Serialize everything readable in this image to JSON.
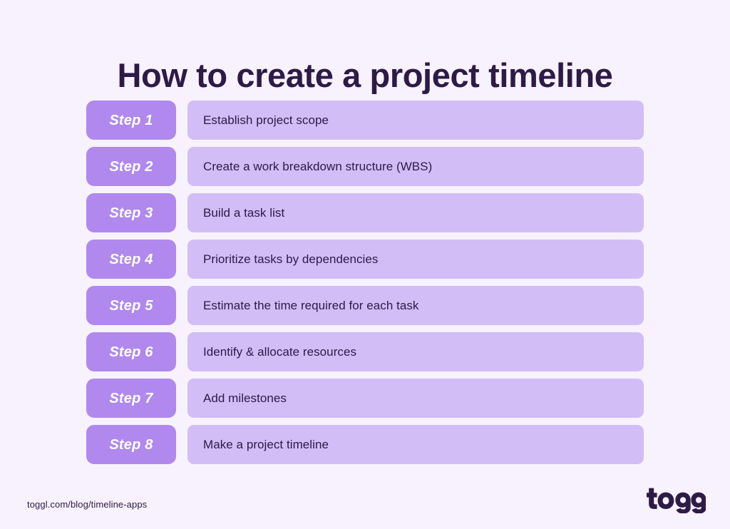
{
  "meta": {
    "background_color": "#f7f2fd",
    "accent_color": "#b088ee",
    "panel_color": "#d2bdf7",
    "text_color": "#2e1a47"
  },
  "header": {
    "title": "How to create a project timeline"
  },
  "steps": [
    {
      "badge": "Step 1",
      "description": "Establish project scope"
    },
    {
      "badge": "Step 2",
      "description": "Create a work breakdown structure (WBS)"
    },
    {
      "badge": "Step 3",
      "description": "Build a task list"
    },
    {
      "badge": "Step 4",
      "description": "Prioritize tasks by dependencies"
    },
    {
      "badge": "Step 5",
      "description": "Estimate the time required for each task"
    },
    {
      "badge": "Step 6",
      "description": "Identify & allocate resources"
    },
    {
      "badge": "Step 7",
      "description": "Add milestones"
    },
    {
      "badge": "Step 8",
      "description": "Make a project timeline"
    }
  ],
  "footer": {
    "source_url": "toggl.com/blog/timeline-apps",
    "brand_name": "toggl"
  }
}
